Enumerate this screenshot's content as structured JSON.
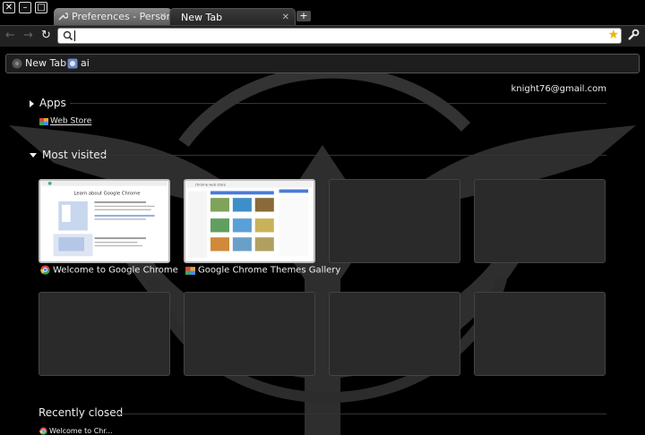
{
  "window": {
    "close_glyph": "✕",
    "min_glyph": "–",
    "max_glyph": "□"
  },
  "tabs": [
    {
      "label": "Preferences - Personal S",
      "active": false
    },
    {
      "label": "New Tab",
      "active": true
    }
  ],
  "new_tab_glyph": "+",
  "toolbar": {
    "back_glyph": "←",
    "forward_glyph": "→",
    "reload_glyph": "↻",
    "omnibox_value": "",
    "star_glyph": "★"
  },
  "bookmarks": [
    {
      "label": "New Tab",
      "icon": "chrome-icon"
    },
    {
      "label": "ai",
      "icon": "ai-app-icon"
    }
  ],
  "ntp": {
    "email": "knight76@gmail.com",
    "apps_heading": "Apps",
    "web_store_label": "Web Store",
    "most_visited_heading": "Most visited",
    "most_visited": [
      {
        "title": "Welcome to Google Chrome",
        "icon": "chrome-icon",
        "preview": "Learn about Google Chrome"
      },
      {
        "title": "Google Chrome Themes Gallery",
        "icon": "web-store-icon",
        "preview": "chrome web store"
      },
      {
        "title": "",
        "icon": "",
        "preview": ""
      },
      {
        "title": "",
        "icon": "",
        "preview": ""
      },
      {
        "title": "",
        "icon": "",
        "preview": ""
      },
      {
        "title": "",
        "icon": "",
        "preview": ""
      },
      {
        "title": "",
        "icon": "",
        "preview": ""
      },
      {
        "title": "",
        "icon": "",
        "preview": ""
      }
    ],
    "recently_closed_heading": "Recently closed",
    "recently_closed": [
      {
        "label": "Welcome to Chr...",
        "icon": "chrome-icon"
      }
    ]
  },
  "colors": {
    "background": "#000000",
    "emblem": "#2e2e2e",
    "tile": "#2a2a2a",
    "text": "#eeeeee",
    "star": "#e8b800"
  }
}
